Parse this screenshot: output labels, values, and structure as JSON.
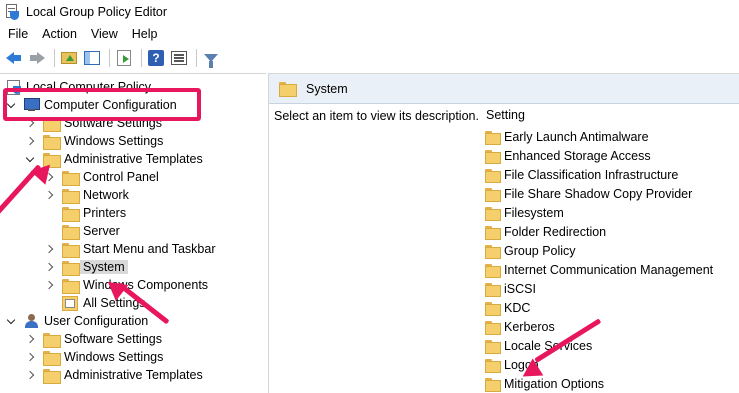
{
  "window": {
    "title": "Local Group Policy Editor"
  },
  "menubar": {
    "items": [
      "File",
      "Action",
      "View",
      "Help"
    ]
  },
  "toolbar": {
    "buttons": [
      {
        "name": "back-button",
        "icon": "arrow-left-icon"
      },
      {
        "name": "forward-button",
        "icon": "arrow-right-icon"
      },
      {
        "name": "up-one-level-button",
        "icon": "folder-up-icon"
      },
      {
        "name": "show-hide-console-tree-button",
        "icon": "console-tree-icon"
      },
      {
        "name": "export-list-button",
        "icon": "export-icon"
      },
      {
        "name": "help-button",
        "icon": "help-icon",
        "glyph": "?"
      },
      {
        "name": "extended-view-button",
        "icon": "view-icon"
      },
      {
        "name": "filter-button",
        "icon": "filter-icon"
      }
    ]
  },
  "tree": {
    "items": [
      {
        "label": "Local Computer Policy"
      },
      {
        "label": "Computer Configuration"
      },
      {
        "label": "Software Settings"
      },
      {
        "label": "Windows Settings"
      },
      {
        "label": "Administrative Templates"
      },
      {
        "label": "Control Panel"
      },
      {
        "label": "Network"
      },
      {
        "label": "Printers"
      },
      {
        "label": "Server"
      },
      {
        "label": "Start Menu and Taskbar"
      },
      {
        "label": "System",
        "selected": true
      },
      {
        "label": "Windows Components"
      },
      {
        "label": "All Settings"
      },
      {
        "label": "User Configuration"
      },
      {
        "label": "Software Settings"
      },
      {
        "label": "Windows Settings"
      },
      {
        "label": "Administrative Templates"
      }
    ]
  },
  "details": {
    "header": "System",
    "description": "Select an item to view its description.",
    "column_header": "Setting",
    "settings": [
      "Early Launch Antimalware",
      "Enhanced Storage Access",
      "File Classification Infrastructure",
      "File Share Shadow Copy Provider",
      "Filesystem",
      "Folder Redirection",
      "Group Policy",
      "Internet Communication Management",
      "iSCSI",
      "KDC",
      "Kerberos",
      "Locale Services",
      "Logon",
      "Mitigation Options"
    ]
  },
  "annotations": {
    "color": "#e8175d"
  }
}
